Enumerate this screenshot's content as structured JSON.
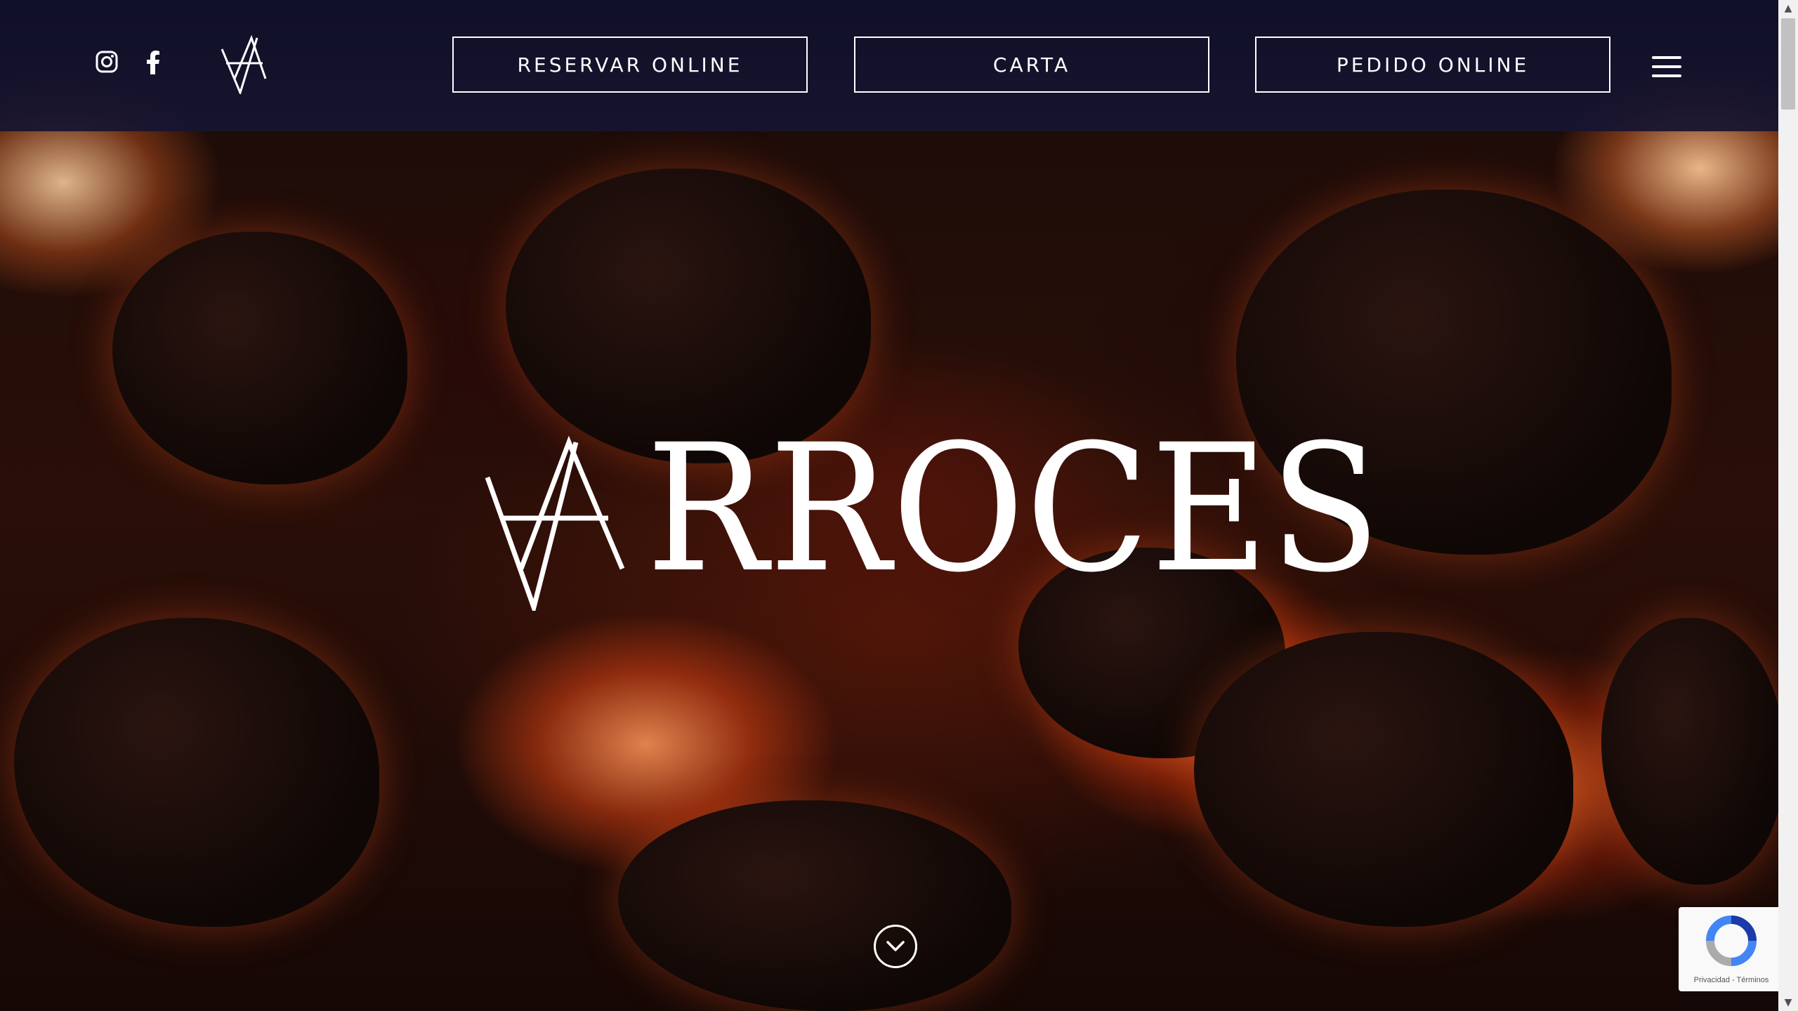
{
  "header": {
    "social": [
      {
        "name": "instagram",
        "icon": "instagram-icon"
      },
      {
        "name": "facebook",
        "icon": "facebook-icon"
      }
    ],
    "logo_icon": "va-monogram-icon",
    "nav_buttons": [
      {
        "label": "RESERVAR ONLINE"
      },
      {
        "label": "CARTA"
      },
      {
        "label": "PEDIDO ONLINE"
      }
    ],
    "menu_icon": "hamburger-menu-icon"
  },
  "hero": {
    "brand_word": "RROCES",
    "scroll_icon": "chevron-down-icon"
  },
  "recaptcha": {
    "privacy": "Privacidad",
    "separator": " - ",
    "terms": "Términos"
  },
  "colors": {
    "header_bg": "#12122c",
    "button_border": "#ffffff",
    "text": "#ffffff"
  }
}
